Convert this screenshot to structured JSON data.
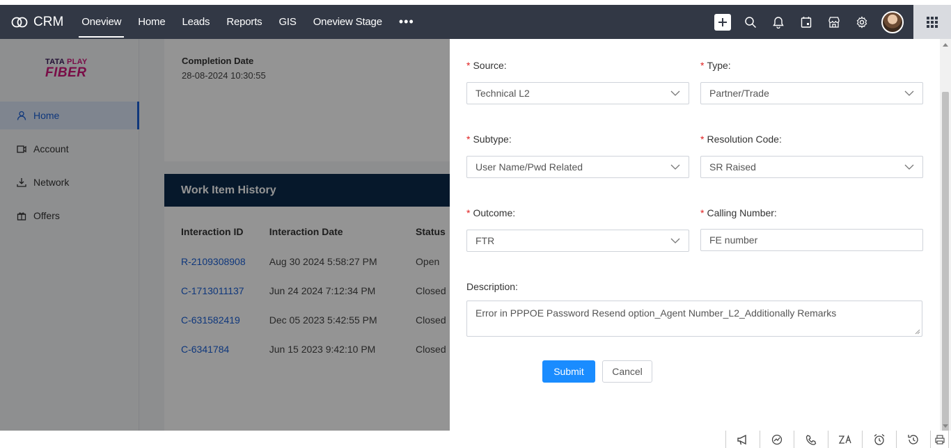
{
  "app": {
    "name": "CRM"
  },
  "nav": {
    "tabs": [
      {
        "label": "Oneview",
        "active": true
      },
      {
        "label": "Home"
      },
      {
        "label": "Leads"
      },
      {
        "label": "Reports"
      },
      {
        "label": "GIS"
      },
      {
        "label": "Oneview Stage"
      }
    ],
    "more": "•••",
    "icons": [
      "plus-icon",
      "search-icon",
      "bell-icon",
      "calendar-icon",
      "store-icon",
      "gear-icon",
      "avatar",
      "apps-grid-icon"
    ]
  },
  "sidebar": {
    "logo": {
      "line1a": "TATA",
      "line1b": "PLAY",
      "line2": "FIBER"
    },
    "items": [
      {
        "label": "Home",
        "icon": "person-icon",
        "active": true
      },
      {
        "label": "Account",
        "icon": "account-icon"
      },
      {
        "label": "Network",
        "icon": "network-icon"
      },
      {
        "label": "Offers",
        "icon": "gift-icon"
      }
    ]
  },
  "completion": {
    "label": "Completion Date",
    "value": "28-08-2024 10:30:55"
  },
  "work_item_history": {
    "title": "Work Item History",
    "columns": [
      "Interaction ID",
      "Interaction Date",
      "Status"
    ],
    "rows": [
      [
        "R-2109308908",
        "Aug 30 2024 5:58:27 PM",
        "Open"
      ],
      [
        "C-1713011137",
        "Jun 24 2024 7:12:34 PM",
        "Closed"
      ],
      [
        "C-631582419",
        "Dec 05 2023 5:42:55 PM",
        "Closed"
      ],
      [
        "C-6341784",
        "Jun 15 2023 9:42:10 PM",
        "Closed"
      ]
    ]
  },
  "form": {
    "source": {
      "label": "Source:",
      "value": "Technical L2",
      "required": true
    },
    "type": {
      "label": "Type:",
      "value": "Partner/Trade",
      "required": true
    },
    "subtype": {
      "label": "Subtype:",
      "value": "User Name/Pwd Related",
      "required": true
    },
    "resolution_code": {
      "label": "Resolution Code:",
      "value": "SR Raised",
      "required": true
    },
    "outcome": {
      "label": "Outcome:",
      "value": "FTR",
      "required": true
    },
    "calling_number": {
      "label": "Calling Number:",
      "value": "FE number",
      "required": true
    },
    "description": {
      "label": "Description:",
      "value": "Error in PPPOE Password Resend option_Agent Number_L2_Additionally Remarks"
    },
    "submit_label": "Submit",
    "cancel_label": "Cancel"
  },
  "bottom_tools": [
    "megaphone-icon",
    "chart-icon",
    "phone-icon",
    "translate-icon",
    "alarm-icon",
    "history-icon"
  ],
  "colors": {
    "navbar": "#323845",
    "primary": "#1a8cff",
    "wih_header": "#0b2a4a",
    "link": "#1a60d6",
    "required": "#e02020"
  }
}
